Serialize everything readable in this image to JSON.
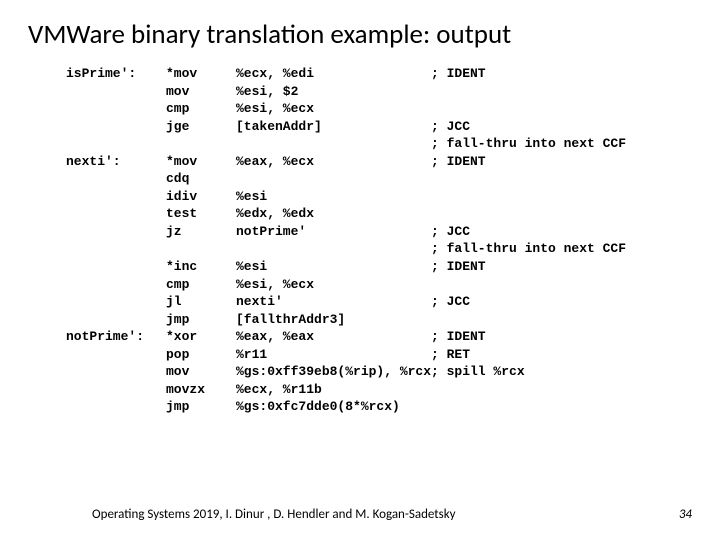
{
  "title": "VMWare binary translation example: output",
  "code": [
    {
      "label": "isPrime':",
      "op": "*mov",
      "args": "%ecx, %edi",
      "comment": "; IDENT"
    },
    {
      "label": "",
      "op": "mov",
      "args": "%esi, $2",
      "comment": ""
    },
    {
      "label": "",
      "op": "cmp",
      "args": "%esi, %ecx",
      "comment": ""
    },
    {
      "label": "",
      "op": "jge",
      "args": "[takenAddr]",
      "comment": "; JCC"
    },
    {
      "label": "",
      "op": "",
      "args": "",
      "comment": "; fall-thru into next CCF"
    },
    {
      "label": "nexti':",
      "op": "*mov",
      "args": "%eax, %ecx",
      "comment": "; IDENT"
    },
    {
      "label": "",
      "op": "cdq",
      "args": "",
      "comment": ""
    },
    {
      "label": "",
      "op": "idiv",
      "args": "%esi",
      "comment": ""
    },
    {
      "label": "",
      "op": "test",
      "args": "%edx, %edx",
      "comment": ""
    },
    {
      "label": "",
      "op": "jz",
      "args": "notPrime'",
      "comment": "; JCC"
    },
    {
      "label": "",
      "op": "",
      "args": "",
      "comment": "; fall-thru into next CCF"
    },
    {
      "label": "",
      "op": "*inc",
      "args": "%esi",
      "comment": "; IDENT"
    },
    {
      "label": "",
      "op": "cmp",
      "args": "%esi, %ecx",
      "comment": ""
    },
    {
      "label": "",
      "op": "jl",
      "args": "nexti'",
      "comment": "; JCC"
    },
    {
      "label": "",
      "op": "jmp",
      "args": "[fallthrAddr3]",
      "comment": ""
    },
    {
      "label": "",
      "op": "",
      "args": "",
      "comment": ""
    },
    {
      "label": "notPrime':",
      "op": "*xor",
      "args": "%eax, %eax",
      "comment": "; IDENT"
    },
    {
      "label": "",
      "op": "pop",
      "args": "%r11",
      "comment": "; RET"
    },
    {
      "label": "",
      "op": "mov",
      "args": "%gs:0xff39eb8(%rip), %rcx",
      "comment": "; spill %rcx"
    },
    {
      "label": "",
      "op": "movzx",
      "args": "%ecx, %r11b",
      "comment": ""
    },
    {
      "label": "",
      "op": "jmp",
      "args": "%gs:0xfc7dde0(8*%rcx)",
      "comment": ""
    }
  ],
  "footer": "Operating Systems  2019, I. Dinur , D. Hendler and M. Kogan-Sadetsky",
  "page": "34"
}
